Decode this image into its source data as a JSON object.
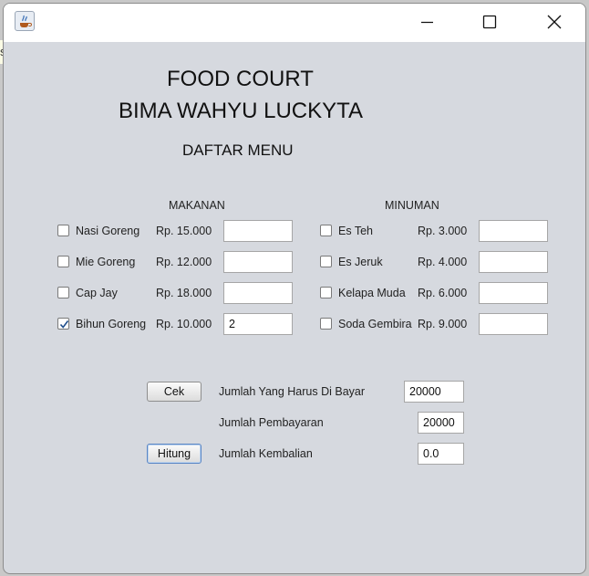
{
  "background": {
    "fragment": "s"
  },
  "titlebar": {
    "title": ""
  },
  "header": {
    "title": "FOOD COURT",
    "owner": "BIMA WAHYU LUCKYTA",
    "menu_title": "DAFTAR MENU"
  },
  "makanan": {
    "heading": "MAKANAN",
    "items": [
      {
        "name": "Nasi Goreng",
        "price": "Rp. 15.000",
        "qty": "",
        "checked": false
      },
      {
        "name": "Mie Goreng",
        "price": "Rp. 12.000",
        "qty": "",
        "checked": false
      },
      {
        "name": "Cap Jay",
        "price": "Rp. 18.000",
        "qty": "",
        "checked": false
      },
      {
        "name": "Bihun Goreng",
        "price": "Rp. 10.000",
        "qty": "2",
        "checked": true
      }
    ]
  },
  "minuman": {
    "heading": "MINUMAN",
    "items": [
      {
        "name": "Es Teh",
        "price": "Rp. 3.000",
        "qty": "",
        "checked": false
      },
      {
        "name": "Es Jeruk",
        "price": "Rp. 4.000",
        "qty": "",
        "checked": false
      },
      {
        "name": "Kelapa Muda",
        "price": "Rp. 6.000",
        "qty": "",
        "checked": false
      },
      {
        "name": "Soda Gembira",
        "price": "Rp. 9.000",
        "qty": "",
        "checked": false
      }
    ]
  },
  "payment": {
    "cek_label": "Cek",
    "hitung_label": "Hitung",
    "total_label": "Jumlah Yang Harus Di Bayar",
    "total_value": "20000",
    "pay_label": "Jumlah Pembayaran",
    "pay_value": "20000",
    "change_label": "Jumlah Kembalian",
    "change_value": "0.0"
  },
  "colors": {
    "window_bg": "#d6d9df",
    "check_accent": "#1f4e8c"
  }
}
